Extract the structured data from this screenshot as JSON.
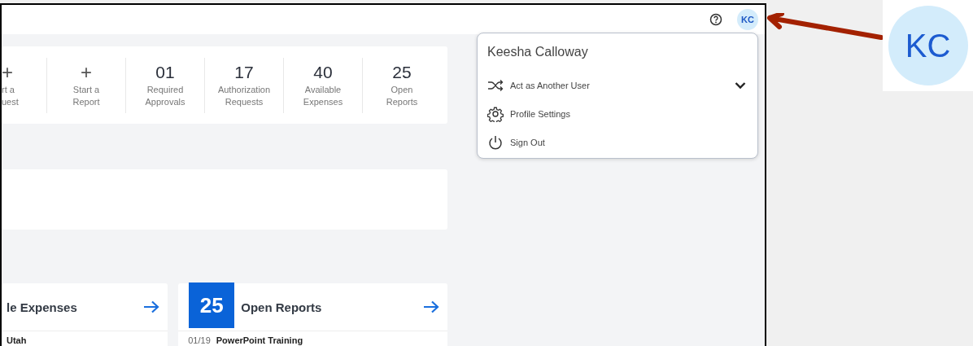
{
  "header": {
    "avatar_initials": "KC"
  },
  "quick_actions": [
    {
      "kind": "action",
      "value": "+",
      "label_lines": [
        "rt a",
        "uest"
      ]
    },
    {
      "kind": "action",
      "value": "+",
      "label_lines": [
        "Start a",
        "Report"
      ]
    },
    {
      "kind": "count",
      "value": "01",
      "label_lines": [
        "Required",
        "Approvals"
      ]
    },
    {
      "kind": "count",
      "value": "17",
      "label_lines": [
        "Authorization",
        "Requests"
      ]
    },
    {
      "kind": "count",
      "value": "40",
      "label_lines": [
        "Available",
        "Expenses"
      ]
    },
    {
      "kind": "count",
      "value": "25",
      "label_lines": [
        "Open",
        "Reports"
      ]
    }
  ],
  "tiles": [
    {
      "title": "le Expenses",
      "rows": [
        {
          "name": "Utah"
        }
      ]
    },
    {
      "count": "25",
      "title": "Open Reports",
      "rows": [
        {
          "date": "01/19",
          "name": "PowerPoint Training"
        }
      ]
    }
  ],
  "profile_menu": {
    "user_name": "Keesha Calloway",
    "items": [
      {
        "kind": "switch",
        "label": "Act as Another User",
        "expandable": true
      },
      {
        "kind": "settings",
        "label": "Profile Settings",
        "expandable": false
      },
      {
        "kind": "signout",
        "label": "Sign Out",
        "expandable": false
      }
    ]
  },
  "callout": {
    "initials": "KC"
  }
}
